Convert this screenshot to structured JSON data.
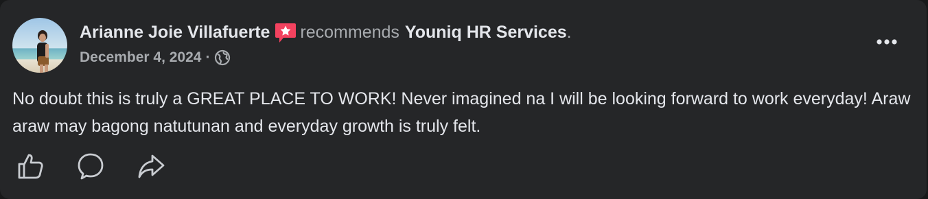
{
  "post": {
    "author": "Arianne Joie Villafuerte",
    "verb": "recommends",
    "page": "Youniq HR Services",
    "period": ".",
    "date": "December 4, 2024",
    "separator": "·",
    "body": "No doubt this is truly a GREAT PLACE TO WORK! Never imagined na I will be looking forward to work everyday! Araw araw may bagong natutunan and everyday growth is truly felt."
  },
  "icons": {
    "recommend_badge": "recommend-badge-icon",
    "privacy": "globe-icon",
    "more": "more-options-icon",
    "like": "like-icon",
    "comment": "comment-icon",
    "share": "share-icon"
  },
  "colors": {
    "card_background": "#252628",
    "page_background": "#18191a",
    "primary_text": "#e4e6eb",
    "secondary_text": "#a8abaf",
    "recommend_badge": "#f3425f"
  }
}
